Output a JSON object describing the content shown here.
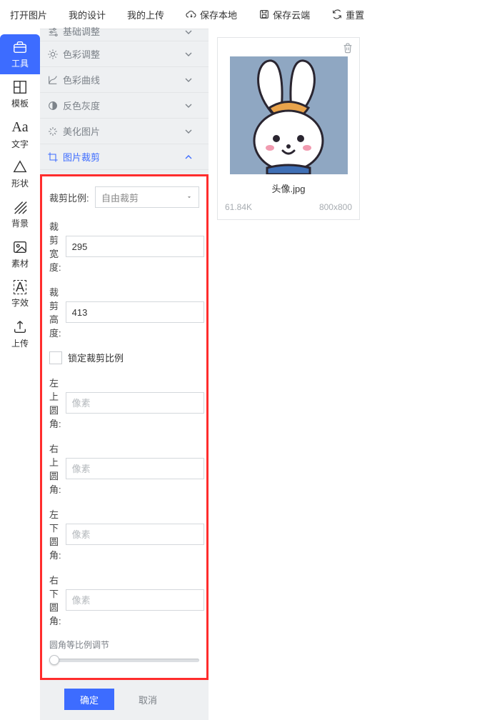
{
  "top_menu": {
    "open": "打开图片",
    "my_design": "我的设计",
    "my_upload": "我的上传",
    "save_local": "保存本地",
    "save_cloud": "保存云端",
    "reset": "重置"
  },
  "rail": {
    "tools": "工具",
    "template": "模板",
    "text": "文字",
    "shape": "形状",
    "background": "背景",
    "material": "素材",
    "text_effect": "字效",
    "upload": "上传"
  },
  "accordion": {
    "basic": "基础调整",
    "color_adjust": "色彩调整",
    "color_curve": "色彩曲线",
    "invert_gray": "反色灰度",
    "beautify": "美化图片",
    "crop": "图片裁剪"
  },
  "crop_form": {
    "ratio_label": "裁剪比例:",
    "ratio_value": "自由裁剪",
    "width_label": "裁剪宽度:",
    "width_value": "295",
    "height_label": "裁剪高度:",
    "height_value": "413",
    "lock_label": "锁定裁剪比例",
    "tl_label": "左上圆角:",
    "tr_label": "右上圆角:",
    "bl_label": "左下圆角:",
    "br_label": "右下圆角:",
    "corner_placeholder": "像素",
    "slider_label": "圆角等比例调节"
  },
  "buttons": {
    "ok": "确定",
    "cancel": "取消"
  },
  "image_card": {
    "filename": "头像.jpg",
    "size": "61.84K",
    "dimensions": "800x800"
  }
}
